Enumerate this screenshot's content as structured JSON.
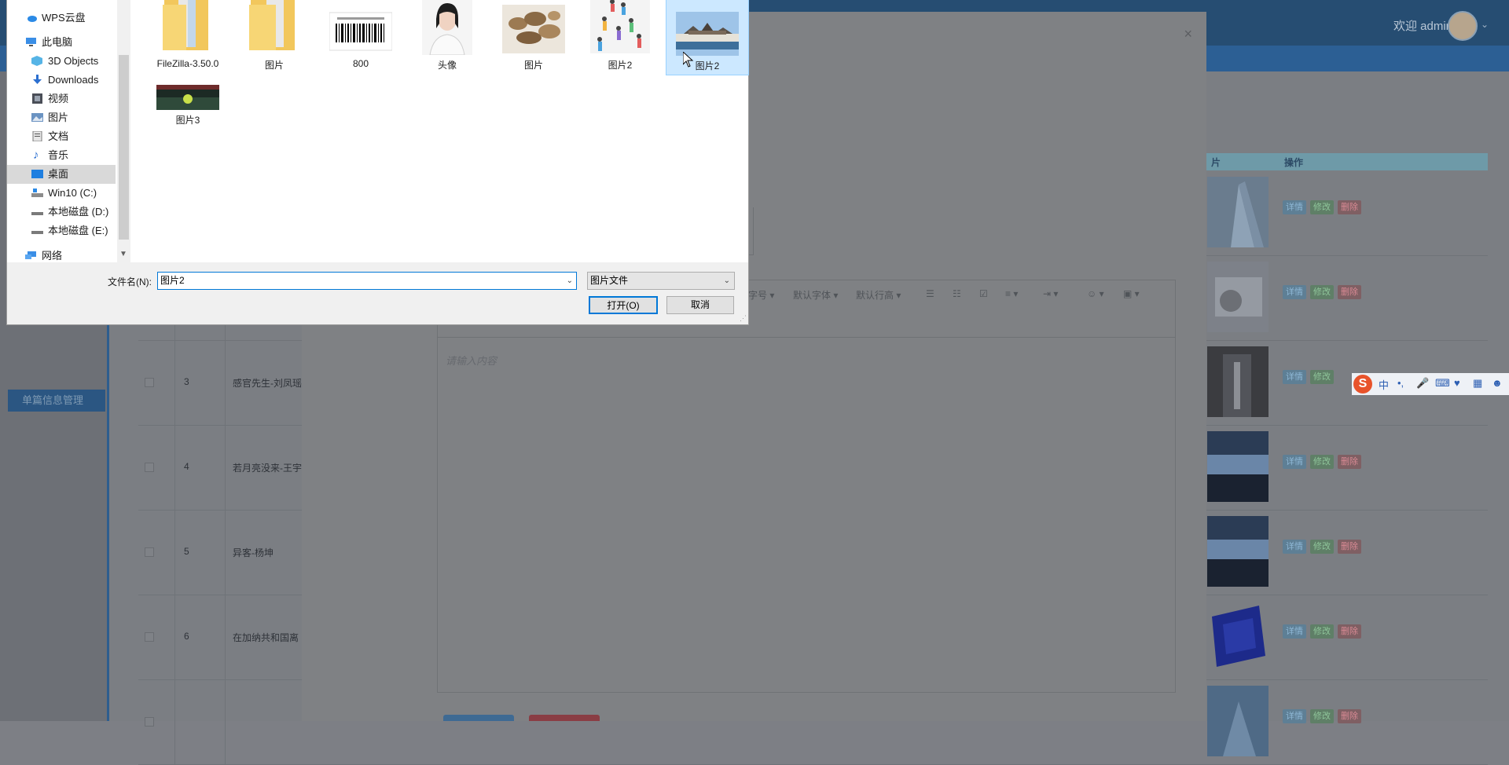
{
  "header": {
    "welcome": "欢迎 admin"
  },
  "sidebar": {
    "partial_item": "单篇信息管理"
  },
  "table": {
    "headers": {
      "image": "片",
      "actions": "操作"
    },
    "buttons": {
      "detail": "详情",
      "edit": "修改",
      "delete": "删除"
    },
    "rows": [
      {
        "no": "",
        "title": ""
      },
      {
        "no": "",
        "title": ""
      },
      {
        "no": "3",
        "title": "感官先生-刘凤瑶"
      },
      {
        "no": "4",
        "title": "若月亮没来-王宇"
      },
      {
        "no": "5",
        "title": "异客-杨坤"
      },
      {
        "no": "6",
        "title": "在加纳共和国离"
      },
      {
        "no": "",
        "title": ""
      }
    ]
  },
  "modal": {
    "close": "×",
    "editor": {
      "toolbar": {
        "font_size": "字号",
        "font_family": "默认字体",
        "line_height": "默认行高"
      },
      "placeholder": "请输入内容"
    }
  },
  "ime": {
    "mode": "中",
    "punct": "•,"
  },
  "file_dialog": {
    "nav": [
      {
        "label": "WPS云盘",
        "icon": "cloud-icon"
      },
      {
        "label": "此电脑",
        "icon": "computer-icon"
      },
      {
        "label": "3D Objects",
        "icon": "cube-icon"
      },
      {
        "label": "Downloads",
        "icon": "download-icon"
      },
      {
        "label": "视频",
        "icon": "video-icon"
      },
      {
        "label": "图片",
        "icon": "picture-icon"
      },
      {
        "label": "文档",
        "icon": "document-icon"
      },
      {
        "label": "音乐",
        "icon": "music-icon"
      },
      {
        "label": "桌面",
        "icon": "desktop-icon"
      },
      {
        "label": "Win10 (C:)",
        "icon": "drive-icon"
      },
      {
        "label": "本地磁盘 (D:)",
        "icon": "drive-icon"
      },
      {
        "label": "本地磁盘 (E:)",
        "icon": "drive-icon"
      },
      {
        "label": "网络",
        "icon": "network-icon"
      }
    ],
    "selected_nav": "桌面",
    "files": [
      {
        "name": "FileZilla-3.50.0",
        "kind": "folder"
      },
      {
        "name": "图片",
        "kind": "folder"
      },
      {
        "name": "800",
        "kind": "barcode"
      },
      {
        "name": "头像",
        "kind": "portrait"
      },
      {
        "name": "图片",
        "kind": "herbs"
      },
      {
        "name": "图片2",
        "kind": "people"
      },
      {
        "name": "图片2",
        "kind": "landscape"
      },
      {
        "name": "图片3",
        "kind": "tennis"
      }
    ],
    "selected_file": "图片2",
    "filename_label": "文件名(N):",
    "filename_value": "图片2",
    "filetype_value": "图片文件",
    "open_label": "打开(O)",
    "cancel_label": "取消"
  },
  "colors": {
    "accent": "#0078d7",
    "selection": "#cce8ff",
    "header_bg": "#264d72"
  }
}
